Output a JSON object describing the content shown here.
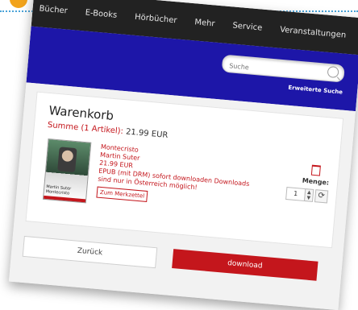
{
  "nav": {
    "items": [
      "Bücher",
      "E-Books",
      "Hörbücher",
      "Mehr",
      "Service",
      "Veranstaltungen"
    ]
  },
  "search": {
    "placeholder": "Suche",
    "advanced_link": "Erweiterte Suche"
  },
  "cart": {
    "title": "Warenkorb",
    "sum_label": "Summe (1 Artikel):",
    "sum_value": "21.99 EUR",
    "item": {
      "cover_text": "Martin Suter Montecristo",
      "title": "Montecristo",
      "author": "Martin Suter",
      "price": "21.99 EUR",
      "note": "EPUB (mit DRM) sofort downloaden Downloads sind nur in Österreich möglich!",
      "notepad_button": "Zum Merkzettel",
      "quantity_label": "Menge:",
      "quantity": "1"
    }
  },
  "actions": {
    "back": "Zurück",
    "download": "download"
  },
  "colors": {
    "nav_bg": "#222222",
    "band_bg": "#1d16a8",
    "accent_red": "#c4161c",
    "badge_orange": "#f2a31b",
    "dotted_line": "#4aa3d8"
  }
}
